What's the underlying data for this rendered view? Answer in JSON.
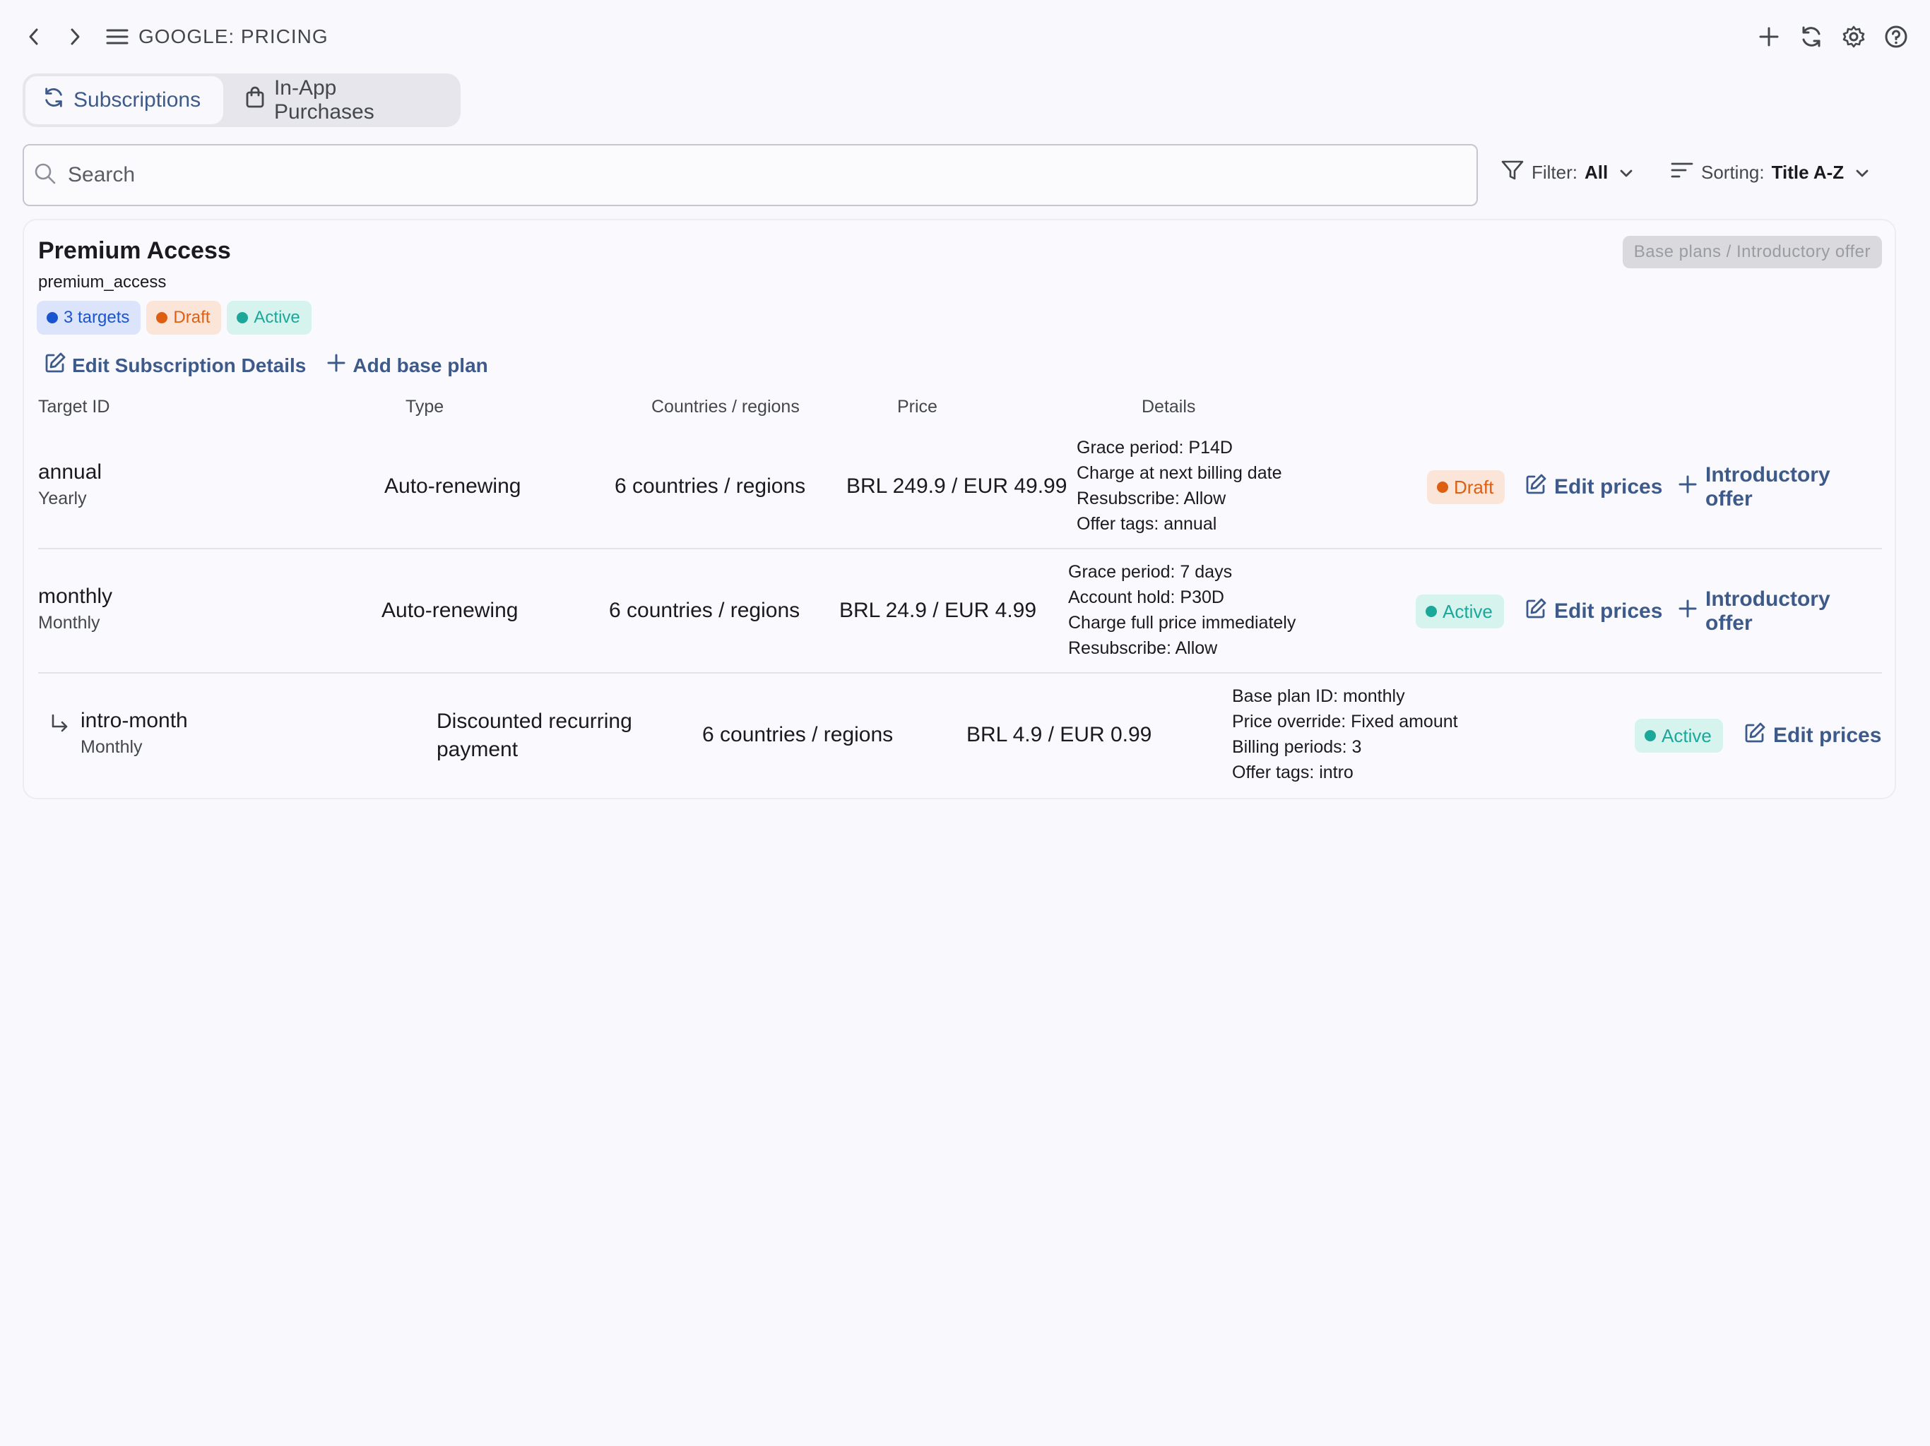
{
  "header": {
    "title": "GOOGLE: PRICING"
  },
  "tabs": [
    {
      "label": "Subscriptions",
      "icon": "refresh-icon",
      "active": true
    },
    {
      "label": "In-App Purchases",
      "icon": "shopping-bag-icon",
      "active": false
    }
  ],
  "search": {
    "placeholder": "Search",
    "value": ""
  },
  "filter": {
    "label": "Filter:",
    "value": "All"
  },
  "sorting": {
    "label": "Sorting:",
    "value": "Title A-Z"
  },
  "product": {
    "title": "Premium Access",
    "id": "premium_access",
    "offer_badge": "Base plans / Introductory offer",
    "chips": [
      {
        "label": "3 targets",
        "color": "#1a55d0"
      },
      {
        "label": "Draft",
        "color": "#df5f12"
      },
      {
        "label": "Active",
        "color": "#1ba89a"
      }
    ],
    "actions": {
      "edit_details": "Edit Subscription Details",
      "add_base_plan": "Add base plan"
    }
  },
  "table": {
    "columns": [
      "Target ID",
      "Type",
      "Countries / regions",
      "Price",
      "Details"
    ],
    "rows": [
      {
        "id": "annual",
        "period": "Yearly",
        "type": "Auto-renewing",
        "countries": "6 countries / regions",
        "price": "BRL 249.9 / EUR 49.99",
        "details": [
          "Grace period: P14D",
          "Charge at next billing date",
          "Resubscribe: Allow",
          "Offer tags: annual"
        ],
        "status": "Draft",
        "edit_prices": "Edit prices",
        "intro_offer": "Introductory offer"
      },
      {
        "id": "monthly",
        "period": "Monthly",
        "type": "Auto-renewing",
        "countries": "6 countries / regions",
        "price": "BRL 24.9 / EUR 4.99",
        "details": [
          "Grace period: 7 days",
          "Account hold: P30D",
          "Charge full price immediately",
          "Resubscribe: Allow"
        ],
        "status": "Active",
        "edit_prices": "Edit prices",
        "intro_offer": "Introductory offer"
      },
      {
        "id": "intro-month",
        "period": "Monthly",
        "type_line1": "Discounted recurring",
        "type_line2": "payment",
        "countries": "6 countries / regions",
        "price": "BRL 4.9 / EUR 0.99",
        "details": [
          "Base plan ID: monthly",
          "Price override: Fixed amount",
          "Billing periods: 3",
          "Offer tags: intro"
        ],
        "status": "Active",
        "edit_prices": "Edit prices"
      }
    ]
  },
  "colors": {
    "accent": "#3d5a8a",
    "draft": "#df5f12",
    "active": "#1ba89a",
    "targets": "#1a55d0"
  }
}
